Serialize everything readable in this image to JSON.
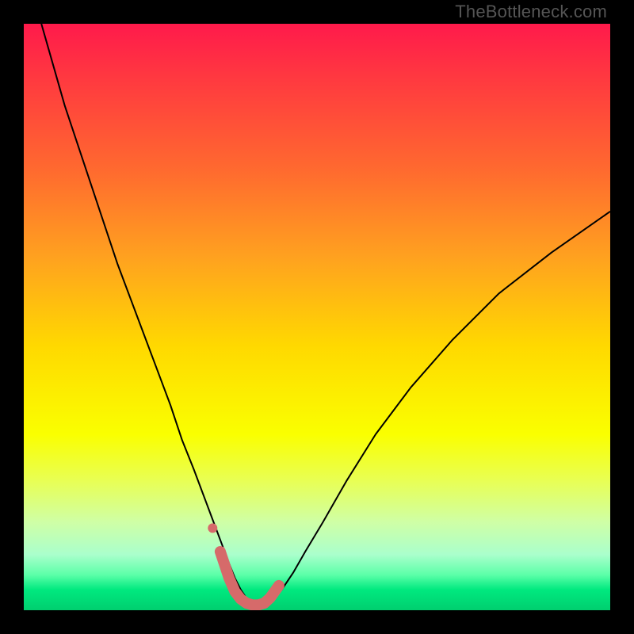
{
  "watermark": "TheBottleneck.com",
  "chart_data": {
    "type": "line",
    "title": "",
    "xlabel": "",
    "ylabel": "",
    "xlim": [
      0,
      100
    ],
    "ylim": [
      0,
      100
    ],
    "grid": false,
    "legend": false,
    "background_gradient_stops": [
      {
        "offset": 0.0,
        "color": "#ff1a4b"
      },
      {
        "offset": 0.1,
        "color": "#ff3b3f"
      },
      {
        "offset": 0.25,
        "color": "#ff6a2f"
      },
      {
        "offset": 0.4,
        "color": "#ffa21f"
      },
      {
        "offset": 0.55,
        "color": "#ffd900"
      },
      {
        "offset": 0.7,
        "color": "#faff00"
      },
      {
        "offset": 0.78,
        "color": "#e8ff55"
      },
      {
        "offset": 0.85,
        "color": "#cfffa6"
      },
      {
        "offset": 0.905,
        "color": "#aaffcc"
      },
      {
        "offset": 0.94,
        "color": "#5bffa8"
      },
      {
        "offset": 0.965,
        "color": "#00e97f"
      },
      {
        "offset": 1.0,
        "color": "#00cf6f"
      }
    ],
    "series": [
      {
        "name": "bottleneck-curve",
        "stroke": "#000000",
        "stroke_width": 2,
        "x": [
          3,
          5,
          7,
          10,
          13,
          16,
          19,
          22,
          25,
          27,
          29,
          30.5,
          32,
          33.5,
          35,
          36,
          37,
          38,
          39,
          40,
          40.5,
          42,
          44,
          46,
          48,
          51,
          55,
          60,
          66,
          73,
          81,
          90,
          100
        ],
        "y": [
          100,
          93,
          86,
          77,
          68,
          59,
          51,
          43,
          35,
          29,
          24,
          20,
          16,
          12,
          8,
          5.5,
          3.5,
          2,
          1,
          0.5,
          0.6,
          1.5,
          3.5,
          6.5,
          10,
          15,
          22,
          30,
          38,
          46,
          54,
          61,
          68
        ]
      },
      {
        "name": "optimal-range-marker",
        "stroke": "#d66a6a",
        "stroke_width": 14,
        "linecap": "round",
        "x": [
          33.5,
          35,
          36,
          37,
          38,
          39,
          40,
          41,
          42,
          43.5
        ],
        "y": [
          10,
          5.5,
          3.2,
          1.9,
          1.2,
          0.9,
          0.9,
          1.2,
          2.1,
          4.2
        ]
      }
    ],
    "markers": [
      {
        "name": "optimal-dot",
        "x": 32.2,
        "y": 14,
        "r": 6,
        "color": "#d66a6a"
      }
    ]
  }
}
